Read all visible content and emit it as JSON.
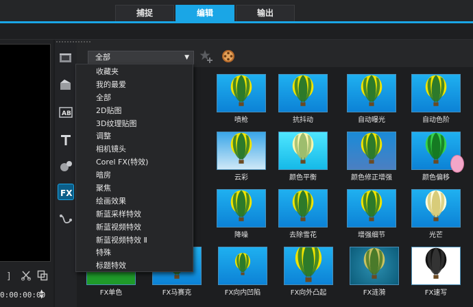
{
  "tabs": [
    {
      "label": "捕捉",
      "active": false
    },
    {
      "label": "编辑",
      "active": true
    },
    {
      "label": "输出",
      "active": false
    }
  ],
  "preview": {
    "timecode": "0:00:00:00"
  },
  "library": {
    "category_selected": "全部",
    "menu_items": [
      "收藏夹",
      "我的最爱",
      "全部",
      "2D贴图",
      "3D纹理贴图",
      "调整",
      "相机镜头",
      "Corel FX(特效)",
      "暗房",
      "聚焦",
      "绘画效果",
      "新蓝采样特效",
      "新蓝视频特效",
      "新蓝视频特效 Ⅱ",
      "特殊",
      "标题特效"
    ],
    "effects": [
      [
        "",
        "喷枪",
        "抗抖动",
        "自动曝光",
        "自动色阶"
      ],
      [
        "",
        "云彩",
        "颜色平衡",
        "颜色修正增强",
        "颜色偏移"
      ],
      [
        "",
        "降噪",
        "去除雪花",
        "增强细节",
        "光芒"
      ],
      [
        "FX单色",
        "FX马赛克",
        "FX向内凹陷",
        "FX向外凸起",
        "FX涟漪",
        "FX速写"
      ]
    ]
  },
  "colors": {
    "accent": "#1aa6e6",
    "menu_bg": "#262729",
    "thumb_sky": "#1fb0f0"
  }
}
